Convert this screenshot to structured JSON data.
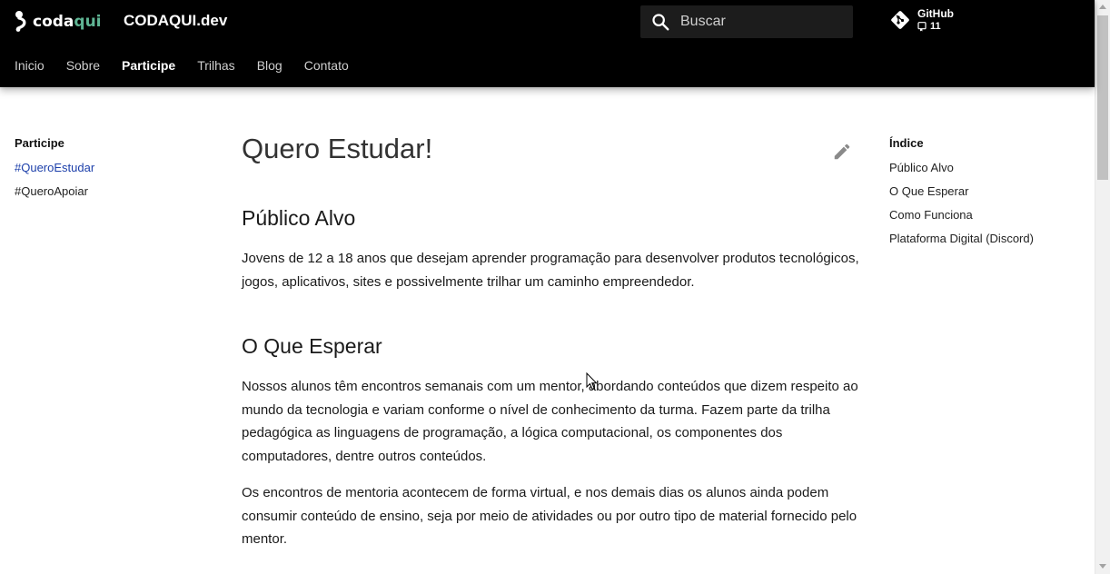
{
  "header": {
    "logo_prefix": "coda",
    "logo_suffix": "qui",
    "site_title": "CODAQUI.dev",
    "search_placeholder": "Buscar",
    "repo_name": "GitHub",
    "repo_count": "11",
    "icon_search": "search-icon",
    "icon_repo": "git-icon",
    "accent_color": "#5fb594"
  },
  "tabs": [
    {
      "label": "Inicio"
    },
    {
      "label": "Sobre"
    },
    {
      "label": "Participe",
      "active": true
    },
    {
      "label": "Trilhas"
    },
    {
      "label": "Blog"
    },
    {
      "label": "Contato"
    }
  ],
  "left_nav": {
    "title": "Participe",
    "items": [
      {
        "label": "#QueroEstudar",
        "active": true
      },
      {
        "label": "#QueroApoiar"
      }
    ]
  },
  "main": {
    "title": "Quero Estudar!",
    "sections": [
      {
        "heading": "Público Alvo",
        "paragraphs": [
          "Jovens de 12 a 18 anos que desejam aprender programação para desenvolver produtos tecnológicos, jogos, aplicativos, sites e possivelmente trilhar um caminho empreendedor."
        ]
      },
      {
        "heading": "O Que Esperar",
        "paragraphs": [
          "Nossos alunos têm encontros semanais com um mentor, abordando conteúdos que dizem respeito ao mundo da tecnologia e variam conforme o nível de conhecimento da turma. Fazem parte da trilha pedagógica as linguagens de programação, a lógica computacional, os componentes dos computadores, dentre outros conteúdos.",
          "Os encontros de mentoria acontecem de forma virtual, e nos demais dias os alunos ainda podem consumir conteúdo de ensino, seja por meio de atividades ou por outro tipo de material fornecido pelo mentor."
        ]
      }
    ]
  },
  "toc": {
    "title": "Índice",
    "items": [
      {
        "label": "Público Alvo"
      },
      {
        "label": "O Que Esperar"
      },
      {
        "label": "Como Funciona"
      },
      {
        "label": "Plataforma Digital (Discord)"
      }
    ]
  },
  "link_color": "#1c3faa"
}
